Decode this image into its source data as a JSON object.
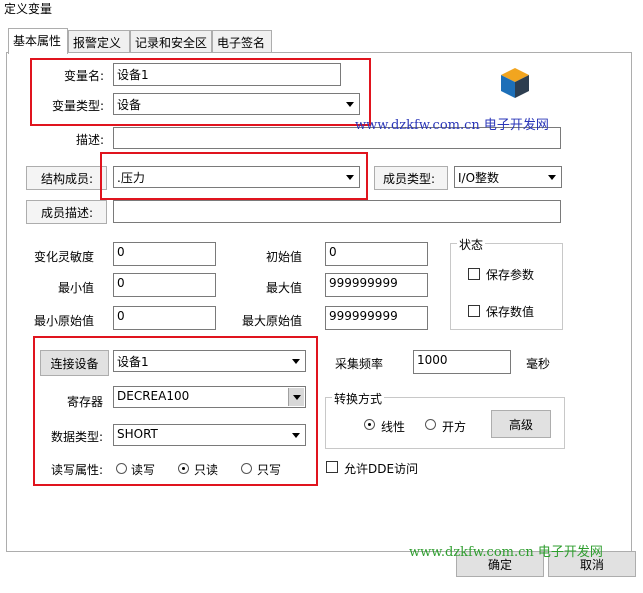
{
  "window": {
    "title": "定义变量"
  },
  "tabs": [
    "基本属性",
    "报警定义",
    "记录和安全区",
    "电子签名"
  ],
  "fields": {
    "var_name_label": "变量名:",
    "var_name": "设备1",
    "var_type_label": "变量类型:",
    "var_type": "设备",
    "desc_label": "描述:",
    "desc": "",
    "member_label": "结构成员:",
    "member": ".压力",
    "member_type_label": "成员类型:",
    "member_type": "I/O整数",
    "member_desc_label": "成员描述:",
    "member_desc": "",
    "sensitivity_label": "变化灵敏度",
    "sensitivity": "0",
    "init_label": "初始值",
    "init": "0",
    "min_label": "最小值",
    "min": "0",
    "max_label": "最大值",
    "max": "999999999",
    "min_raw_label": "最小原始值",
    "min_raw": "0",
    "max_raw_label": "最大原始值",
    "max_raw": "999999999"
  },
  "state_group": {
    "title": "状态",
    "save_param": "保存参数",
    "save_value": "保存数值"
  },
  "io": {
    "connect_button": "连接设备",
    "device": "设备1",
    "register_label": "寄存器",
    "register": "DECREA100",
    "datatype_label": "数据类型:",
    "datatype": "SHORT",
    "rw_label": "读写属性:",
    "rw_options": [
      "读写",
      "只读",
      "只写"
    ],
    "rw_selected": "只读"
  },
  "sampling": {
    "label": "采集频率",
    "value": "1000",
    "unit": "毫秒"
  },
  "conversion": {
    "title": "转换方式",
    "options": [
      "线性",
      "开方"
    ],
    "selected": "线性",
    "advanced_button": "高级"
  },
  "dde": {
    "label": "允许DDE访问"
  },
  "buttons": {
    "ok": "确定",
    "cancel": "取消"
  },
  "watermarks": [
    "www.dzkfw.com.cn 电子开发网",
    "www.dzkfw.com.cn 电子开发网"
  ],
  "colors": {
    "highlight_box": "#e0141e",
    "watermark_blue": "#2a36b8",
    "watermark_green": "#2e9d2e"
  }
}
